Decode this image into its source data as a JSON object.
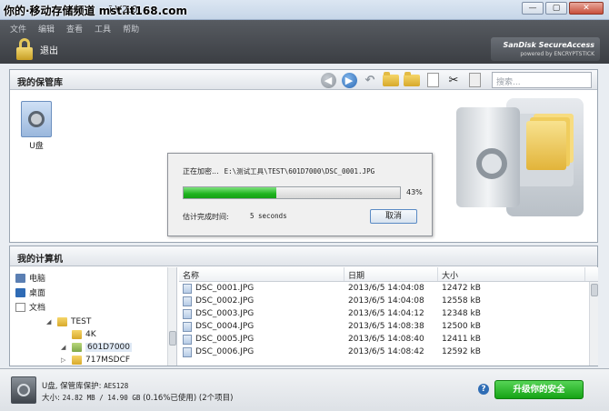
{
  "window": {
    "watermark": "你的·移动存储频道 mst.it168.com",
    "title_partial": "ī V2.0",
    "controls": [
      "—",
      "▢",
      "✕"
    ]
  },
  "menu": [
    "文件",
    "编辑",
    "查看",
    "工具",
    "帮助"
  ],
  "header": {
    "exit_label": "退出",
    "brand_line1": "SanDisk SecureAccess",
    "brand_line2": "powered by ENCRYPTSTICK"
  },
  "vault": {
    "title": "我的保管库",
    "search_placeholder": "搜索...",
    "drive_label": "U盘"
  },
  "progress_dialog": {
    "status_label": "正在加密...",
    "current_file": "E:\\测试工具\\TEST\\601D7000\\DSC_0001.JPG",
    "percent": 43,
    "percent_text": "43%",
    "eta_label": "估计完成时间:",
    "eta_value": "5 seconds",
    "cancel_label": "取消"
  },
  "computer": {
    "title": "我的计算机",
    "tree": [
      {
        "label": "电脑",
        "icon": "computer-icon"
      },
      {
        "label": "桌面",
        "icon": "desktop-icon"
      },
      {
        "label": "文档",
        "icon": "documents-icon"
      },
      {
        "label": "TEST",
        "icon": "folder-icon"
      },
      {
        "label": "4K",
        "icon": "folder-icon"
      },
      {
        "label": "601D7000",
        "icon": "folder-icon"
      },
      {
        "label": "717MSDCF",
        "icon": "folder-icon"
      }
    ],
    "columns": {
      "name": "名称",
      "date": "日期",
      "size": "大小"
    },
    "files": [
      {
        "name": "DSC_0001.JPG",
        "date": "2013/6/5 14:04:08",
        "size": "12472 kB"
      },
      {
        "name": "DSC_0002.JPG",
        "date": "2013/6/5 14:04:08",
        "size": "12558 kB"
      },
      {
        "name": "DSC_0003.JPG",
        "date": "2013/6/5 14:04:12",
        "size": "12348 kB"
      },
      {
        "name": "DSC_0004.JPG",
        "date": "2013/6/5 14:08:38",
        "size": "12500 kB"
      },
      {
        "name": "DSC_0005.JPG",
        "date": "2013/6/5 14:08:40",
        "size": "12411 kB"
      },
      {
        "name": "DSC_0006.JPG",
        "date": "2013/6/5 14:08:42",
        "size": "12592 kB"
      }
    ]
  },
  "footer": {
    "line1_label": "U盘, 保管库保护:",
    "line1_value": "AES128",
    "line2_label": "大小:",
    "line2_value": "24.82 MB / 14.90 GB",
    "line2_suffix": "(0.16%已使用) (2个项目)",
    "help": "?",
    "upgrade_label": "升级你的安全"
  }
}
